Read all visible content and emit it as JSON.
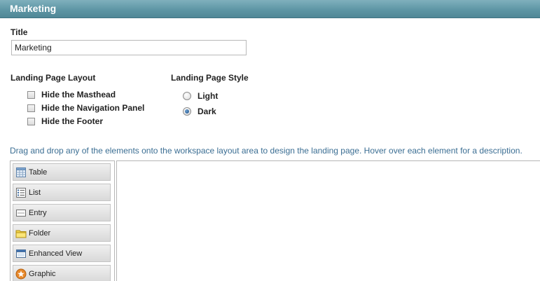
{
  "header": {
    "title": "Marketing"
  },
  "title_field": {
    "label": "Title",
    "value": "Marketing"
  },
  "layout": {
    "heading": "Landing Page Layout",
    "options": [
      {
        "label": "Hide the Masthead",
        "checked": false
      },
      {
        "label": "Hide the Navigation Panel",
        "checked": false
      },
      {
        "label": "Hide the Footer",
        "checked": false
      }
    ]
  },
  "style": {
    "heading": "Landing Page Style",
    "options": [
      {
        "label": "Light",
        "selected": false
      },
      {
        "label": "Dark",
        "selected": true
      }
    ]
  },
  "instruction": "Drag and drop any of the elements onto the workspace layout area to design the landing page. Hover over each element for a description.",
  "palette": {
    "items": [
      {
        "label": "Table",
        "icon": "table-icon"
      },
      {
        "label": "List",
        "icon": "list-icon"
      },
      {
        "label": "Entry",
        "icon": "entry-icon"
      },
      {
        "label": "Folder",
        "icon": "folder-icon"
      },
      {
        "label": "Enhanced View",
        "icon": "enhanced-view-icon"
      },
      {
        "label": "Graphic",
        "icon": "graphic-icon"
      }
    ]
  },
  "colors": {
    "header": "#5e96a5",
    "instruction_text": "#3b6e93",
    "radio_selected": "#1f4f86"
  }
}
